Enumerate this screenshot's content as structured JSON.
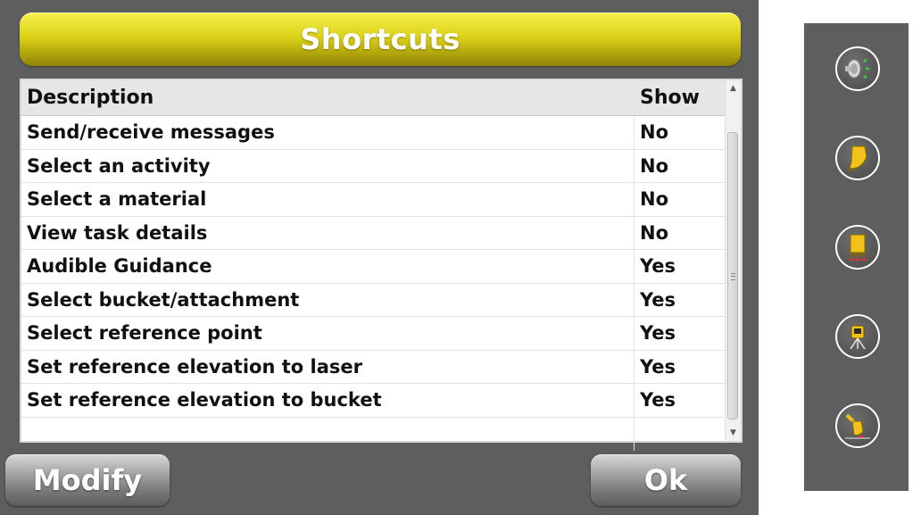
{
  "dialog": {
    "title": "Shortcuts",
    "columns": {
      "description": "Description",
      "show": "Show"
    },
    "rows": [
      {
        "description": "Send/receive messages",
        "show": "No"
      },
      {
        "description": "Select an activity",
        "show": "No"
      },
      {
        "description": "Select a material",
        "show": "No"
      },
      {
        "description": "View task details",
        "show": "No"
      },
      {
        "description": "Audible Guidance",
        "show": "Yes"
      },
      {
        "description": "Select bucket/attachment",
        "show": "Yes"
      },
      {
        "description": "Select reference point",
        "show": "Yes"
      },
      {
        "description": "Set reference elevation to laser",
        "show": "Yes"
      },
      {
        "description": "Set reference elevation to bucket",
        "show": "Yes"
      }
    ],
    "buttons": {
      "modify": "Modify",
      "ok": "Ok"
    }
  },
  "side_panel": {
    "icons": [
      "speaker-icon",
      "bucket-icon",
      "bucket-teeth-icon",
      "laser-receiver-icon",
      "excavator-arm-icon"
    ]
  },
  "colors": {
    "title_bar": "#dcd21a",
    "panel_bg": "#5e5e5e",
    "button_gray": "#8a8a8a"
  }
}
